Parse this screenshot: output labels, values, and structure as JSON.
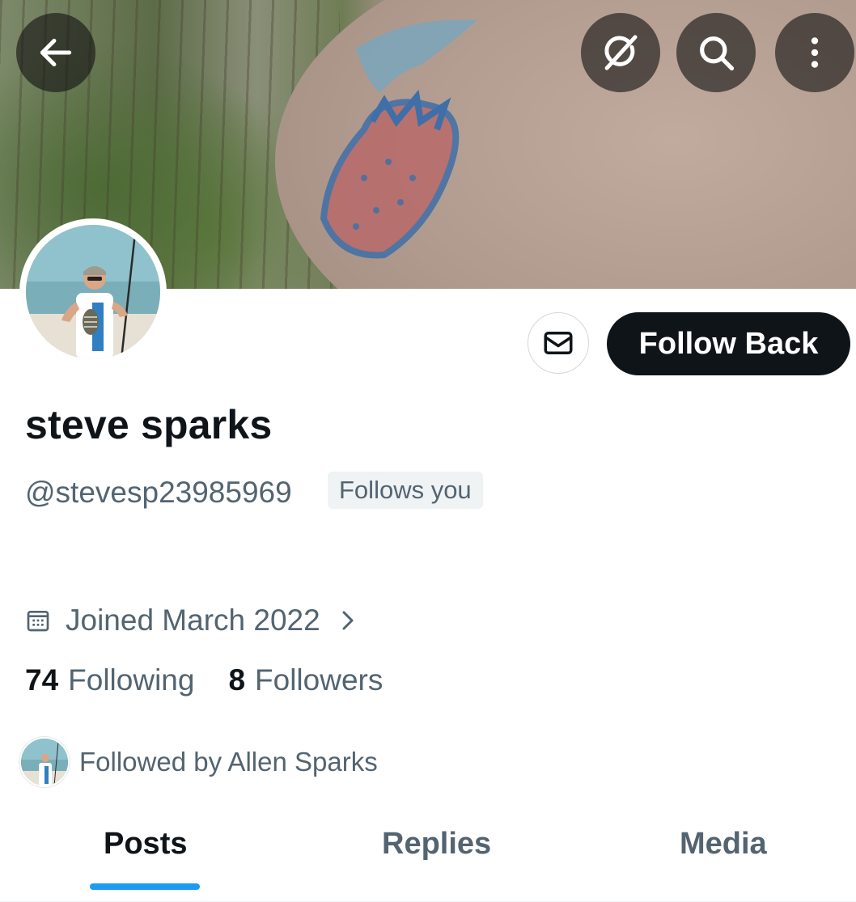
{
  "header": {
    "back_icon": "arrow-left-icon",
    "actions": [
      {
        "name": "grok-icon"
      },
      {
        "name": "search-icon"
      },
      {
        "name": "more-vertical-icon"
      }
    ]
  },
  "profile": {
    "display_name": "steve sparks",
    "handle": "@stevesp23985969",
    "follows_you_badge": "Follows you",
    "joined": "Joined March 2022",
    "following_count": "74",
    "following_label": "Following",
    "followers_count": "8",
    "followers_label": "Followers",
    "followed_by": "Followed by Allen Sparks"
  },
  "actions": {
    "message_icon": "envelope-icon",
    "follow_back_label": "Follow Back"
  },
  "tabs": [
    {
      "label": "Posts",
      "active": true
    },
    {
      "label": "Replies",
      "active": false
    },
    {
      "label": "Media",
      "active": false
    }
  ],
  "colors": {
    "accent": "#1d9bf0",
    "text_primary": "#0f1419",
    "text_secondary": "#536471"
  }
}
